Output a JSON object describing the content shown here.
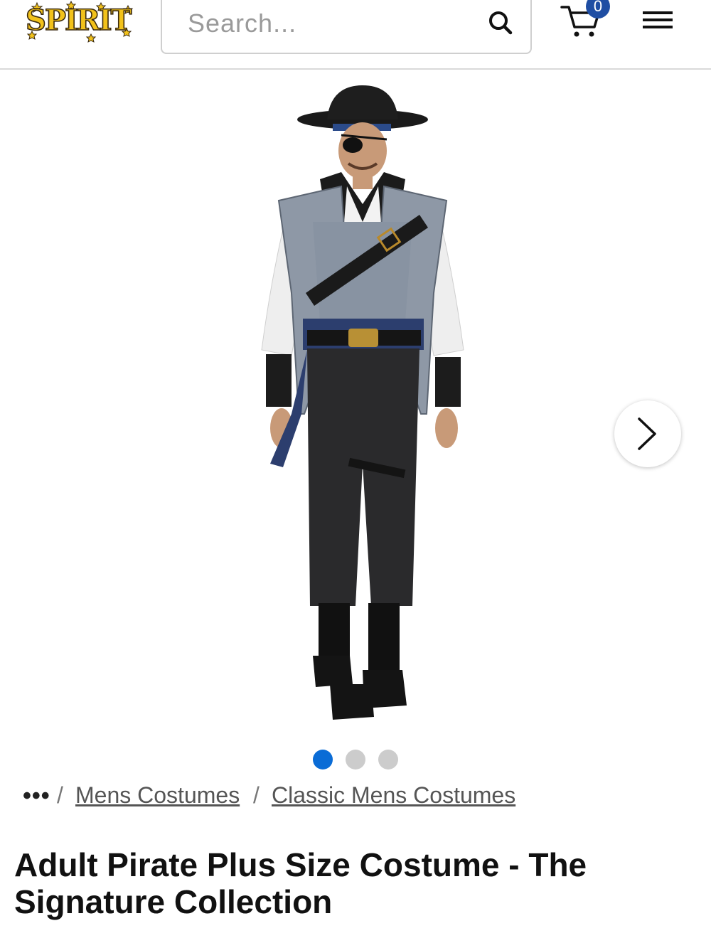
{
  "header": {
    "logo_text": "SPIRIT",
    "search": {
      "placeholder": "Search...",
      "value": ""
    },
    "cart": {
      "count": "0"
    }
  },
  "product": {
    "image_count": 3,
    "active_image_index": 0,
    "title": "Adult Pirate Plus Size Costume - The Signature Collection"
  },
  "breadcrumb": {
    "ellipsis": "•••",
    "separator": "/",
    "items": [
      "Mens Costumes",
      "Classic Mens Costumes"
    ]
  },
  "colors": {
    "brand_yellow": "#f2c21b",
    "brand_outline": "#3a2a10",
    "accent_blue": "#0a6cd6",
    "badge_blue": "#1f4ea3"
  },
  "icons": {
    "search": "search-icon",
    "cart": "cart-icon",
    "menu": "hamburger-menu-icon",
    "next": "chevron-right-icon"
  }
}
